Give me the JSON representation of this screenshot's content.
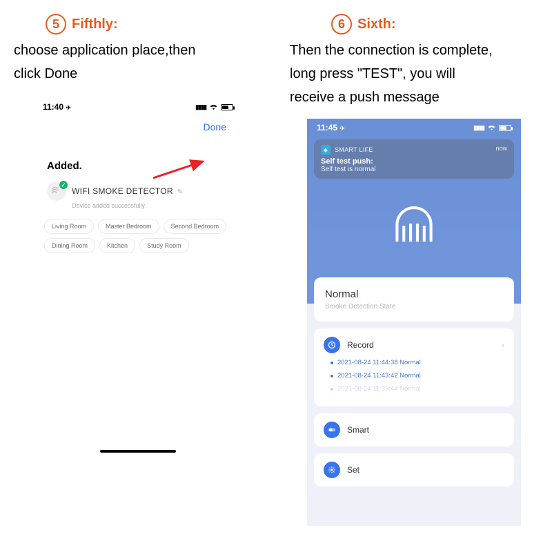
{
  "left": {
    "badge": "5",
    "title": "Fifthly:",
    "desc_line1": "choose application place,then",
    "desc_line2": "click Done",
    "status_time": "11:40",
    "done": "Done",
    "added": "Added.",
    "device_name": "WIFI  SMOKE DETECTOR",
    "device_sub": "Device added successfully",
    "chips": [
      "Living Room",
      "Master Bedroom",
      "Second Bedroom",
      "Dining Room",
      "Kitchen",
      "Study Room"
    ]
  },
  "right": {
    "badge": "6",
    "title": "Sixth:",
    "desc_line1": "Then the connection is complete,",
    "desc_line2": "long press \"TEST\", you will",
    "desc_line3": "receive a push message",
    "status_time": "11:45",
    "push_app": "SMART LIFE",
    "push_now": "now",
    "push_title": "Self test push:",
    "push_body": "Self test is normal",
    "state_title": "Normal",
    "state_sub": "Smoke Detection State",
    "record_label": "Record",
    "records": [
      "2021-08-24 11:44:38 Normal",
      "2021-08-24 11:43:42 Normal",
      "2021-08-24 11:39:44 Normal"
    ],
    "smart_label": "Smart",
    "set_label": "Set"
  }
}
